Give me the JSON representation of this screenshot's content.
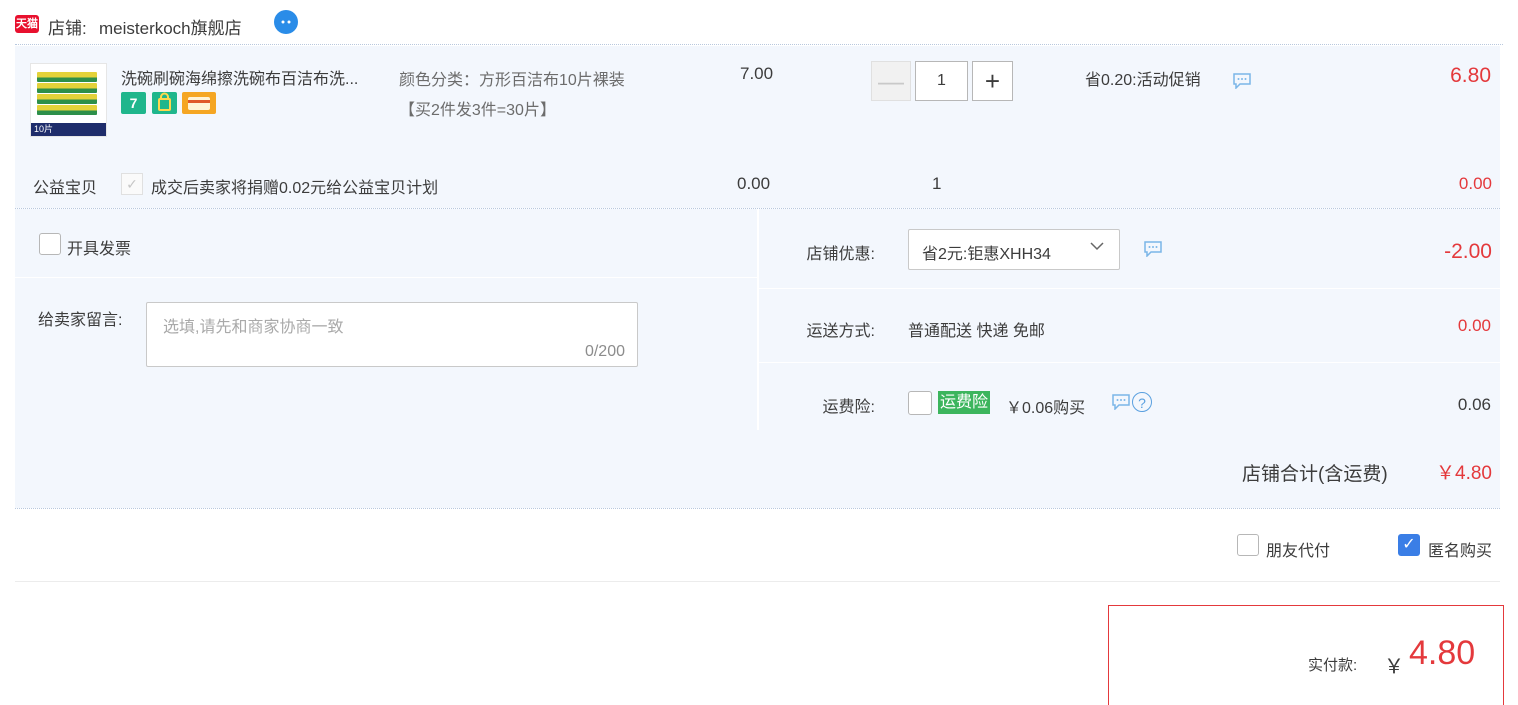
{
  "shop": {
    "platform_badge": "天猫",
    "prefix": "店铺:",
    "name": "meisterkoch旗舰店"
  },
  "item": {
    "thumb_caption": "10片",
    "title": "洗碗刷碗海绵擦洗碗布百洁布洗...",
    "sku_line1": "颜色分类：方形百洁布10片裸装",
    "sku_line2": "【买2件发3件=30片】",
    "price": "7.00",
    "quantity": "1",
    "qty_minus": "—",
    "qty_plus": "+",
    "promo": "省0.20:活动促销",
    "line_total": "6.80"
  },
  "charity": {
    "label": "公益宝贝",
    "check_mark": "✓",
    "text": "成交后卖家将捐赠0.02元给公益宝贝计划",
    "price": "0.00",
    "quantity": "1",
    "total": "0.00"
  },
  "invoice": {
    "label": "开具发票"
  },
  "message": {
    "label": "给卖家留言:",
    "placeholder": "选填,请先和商家协商一致",
    "counter": "0/200"
  },
  "store_coupon": {
    "label": "店铺优惠:",
    "selected": "省2元:钜惠XHH34",
    "amount": "-2.00"
  },
  "shipping": {
    "label": "运送方式:",
    "method": "普通配送 快递 免邮",
    "fee": "0.00"
  },
  "insurance": {
    "label": "运费险:",
    "badge": "运费险",
    "price": "￥0.06购买",
    "help": "?",
    "fee": "0.06"
  },
  "shop_total": {
    "label": "店铺合计(含运费)",
    "value": "￥4.80"
  },
  "options": {
    "friend_pay": "朋友代付",
    "anonymous": "匿名购买",
    "anonymous_mark": "✓"
  },
  "payment": {
    "label": "实付款:",
    "currency": "￥",
    "value": "4.80"
  },
  "colors": {
    "price_red": "#e4393c",
    "panel_bg": "#f3f7fd",
    "check_blue": "#3a7ee6",
    "insurance_green": "#3cb55d"
  }
}
